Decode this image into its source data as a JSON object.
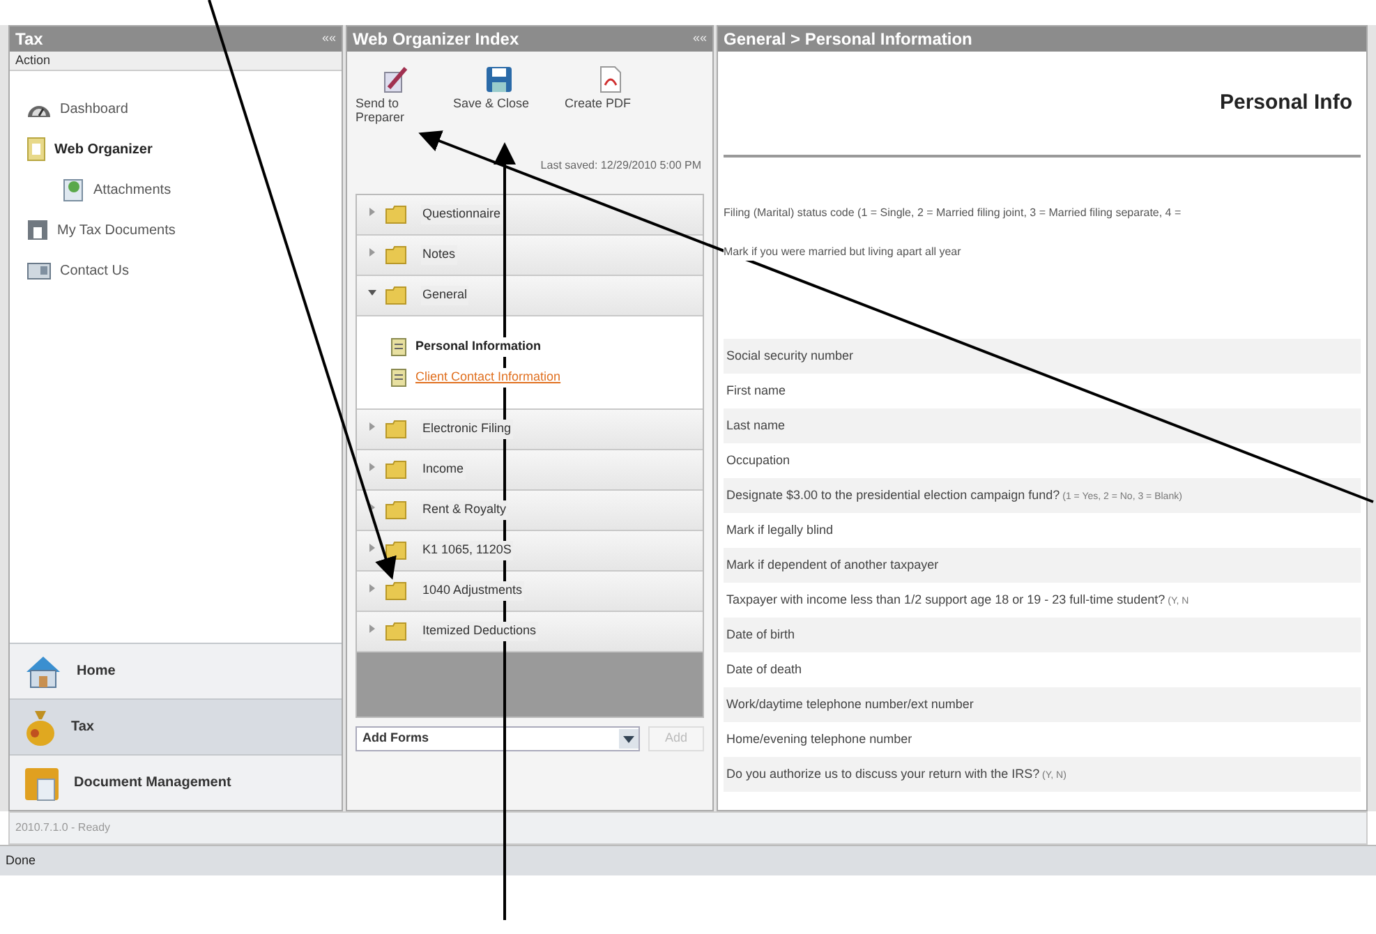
{
  "left_panel": {
    "title": "Tax",
    "collapse": "««",
    "action_label": "Action",
    "items": [
      {
        "label": "Dashboard",
        "selected": false
      },
      {
        "label": "Web Organizer",
        "selected": true,
        "children": [
          {
            "label": "Attachments",
            "selected": false
          }
        ]
      },
      {
        "label": "My Tax Documents",
        "selected": false
      },
      {
        "label": "Contact Us",
        "selected": false
      }
    ],
    "nav": [
      {
        "label": "Home",
        "selected": false
      },
      {
        "label": "Tax",
        "selected": true
      },
      {
        "label": "Document Management",
        "selected": false
      }
    ]
  },
  "index_panel": {
    "title": "Web Organizer Index",
    "collapse": "««",
    "toolbar": [
      {
        "label": "Send to Preparer"
      },
      {
        "label": "Save & Close"
      },
      {
        "label": "Create PDF"
      }
    ],
    "last_saved": "Last saved: 12/29/2010 5:00 PM",
    "tree": [
      {
        "label": "Questionnaire",
        "expanded": false
      },
      {
        "label": "Notes",
        "expanded": false
      },
      {
        "label": "General",
        "expanded": true,
        "children": [
          {
            "label": "Personal Information",
            "selected": true
          },
          {
            "label": "Client Contact Information",
            "selected": false
          }
        ]
      },
      {
        "label": "Electronic Filing",
        "expanded": false
      },
      {
        "label": "Income",
        "expanded": false
      },
      {
        "label": "Rent & Royalty",
        "expanded": false
      },
      {
        "label": "K1 1065, 1120S",
        "expanded": false
      },
      {
        "label": "1040 Adjustments",
        "expanded": false
      },
      {
        "label": "Itemized Deductions",
        "expanded": false
      }
    ],
    "add_forms": {
      "value": "Add Forms",
      "button": "Add",
      "disabled": true
    }
  },
  "form_panel": {
    "breadcrumb": "General > Personal Information",
    "heading": "Personal Info",
    "intro": [
      {
        "label": "Filing (Marital) status code (1 = Single, 2 = Married filing joint, 3 = Married filing separate, 4 ="
      },
      {
        "label": "Mark if you were married but living apart all year"
      }
    ],
    "rows": [
      {
        "label": "Social security number"
      },
      {
        "label": "First name"
      },
      {
        "label": "Last name"
      },
      {
        "label": "Occupation"
      },
      {
        "label": "Designate $3.00 to the presidential election campaign fund?",
        "hint": "(1 = Yes, 2 = No, 3 = Blank)"
      },
      {
        "label": "Mark if legally blind"
      },
      {
        "label": "Mark if dependent of another taxpayer"
      },
      {
        "label": "Taxpayer with income less than 1/2 support age 18 or 19 - 23 full-time student?",
        "hint": "(Y, N"
      },
      {
        "label": "Date of birth"
      },
      {
        "label": "Date of death"
      },
      {
        "label": "Work/daytime telephone number/ext number"
      },
      {
        "label": "Home/evening telephone number"
      },
      {
        "label": "Do you authorize us to discuss your return with the IRS?",
        "hint": "(Y, N)"
      }
    ]
  },
  "status_bar": "2010.7.1.0 - Ready",
  "browser_status": "Done"
}
